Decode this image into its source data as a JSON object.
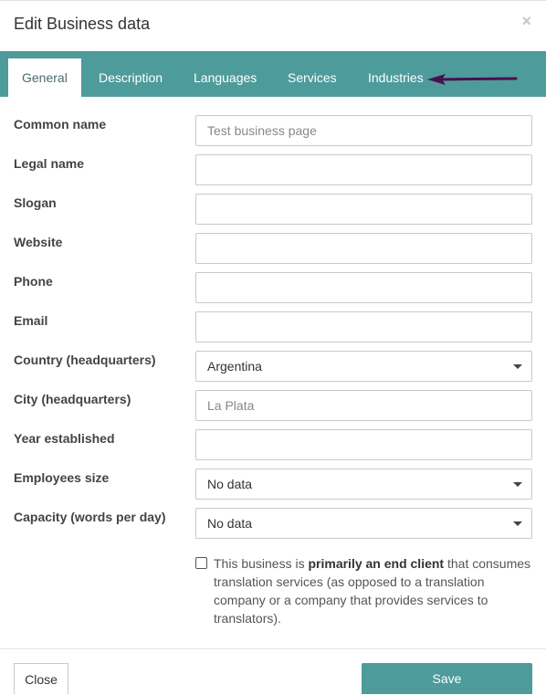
{
  "dialog": {
    "title": "Edit Business data",
    "close_icon": "×"
  },
  "tabs": [
    {
      "label": "General",
      "active": true
    },
    {
      "label": "Description",
      "active": false
    },
    {
      "label": "Languages",
      "active": false
    },
    {
      "label": "Services",
      "active": false
    },
    {
      "label": "Industries",
      "active": false
    }
  ],
  "annotation": {
    "arrow_color": "#4a0f4f",
    "points_to": "Industries"
  },
  "form": {
    "fields": [
      {
        "label": "Common name",
        "type": "text",
        "value": "",
        "placeholder": "Test business page"
      },
      {
        "label": "Legal name",
        "type": "text",
        "value": "",
        "placeholder": ""
      },
      {
        "label": "Slogan",
        "type": "text",
        "value": "",
        "placeholder": ""
      },
      {
        "label": "Website",
        "type": "text",
        "value": "",
        "placeholder": ""
      },
      {
        "label": "Phone",
        "type": "text",
        "value": "",
        "placeholder": ""
      },
      {
        "label": "Email",
        "type": "text",
        "value": "",
        "placeholder": ""
      },
      {
        "label": "Country (headquarters)",
        "type": "select",
        "value": "Argentina"
      },
      {
        "label": "City (headquarters)",
        "type": "text",
        "value": "",
        "placeholder": "La Plata"
      },
      {
        "label": "Year established",
        "type": "text",
        "value": "",
        "placeholder": ""
      },
      {
        "label": "Employees size",
        "type": "select",
        "value": "No data"
      },
      {
        "label": "Capacity (words per day)",
        "type": "select",
        "value": "No data"
      }
    ],
    "end_client_checkbox": {
      "checked": false,
      "text_before": "This business is ",
      "text_bold": "primarily an end client",
      "text_after": " that consumes translation services (as opposed to a translation company or a company that provides services to translators)."
    }
  },
  "footer": {
    "close_label": "Close",
    "save_label": "Save"
  },
  "colors": {
    "accent": "#4e9b9b"
  }
}
